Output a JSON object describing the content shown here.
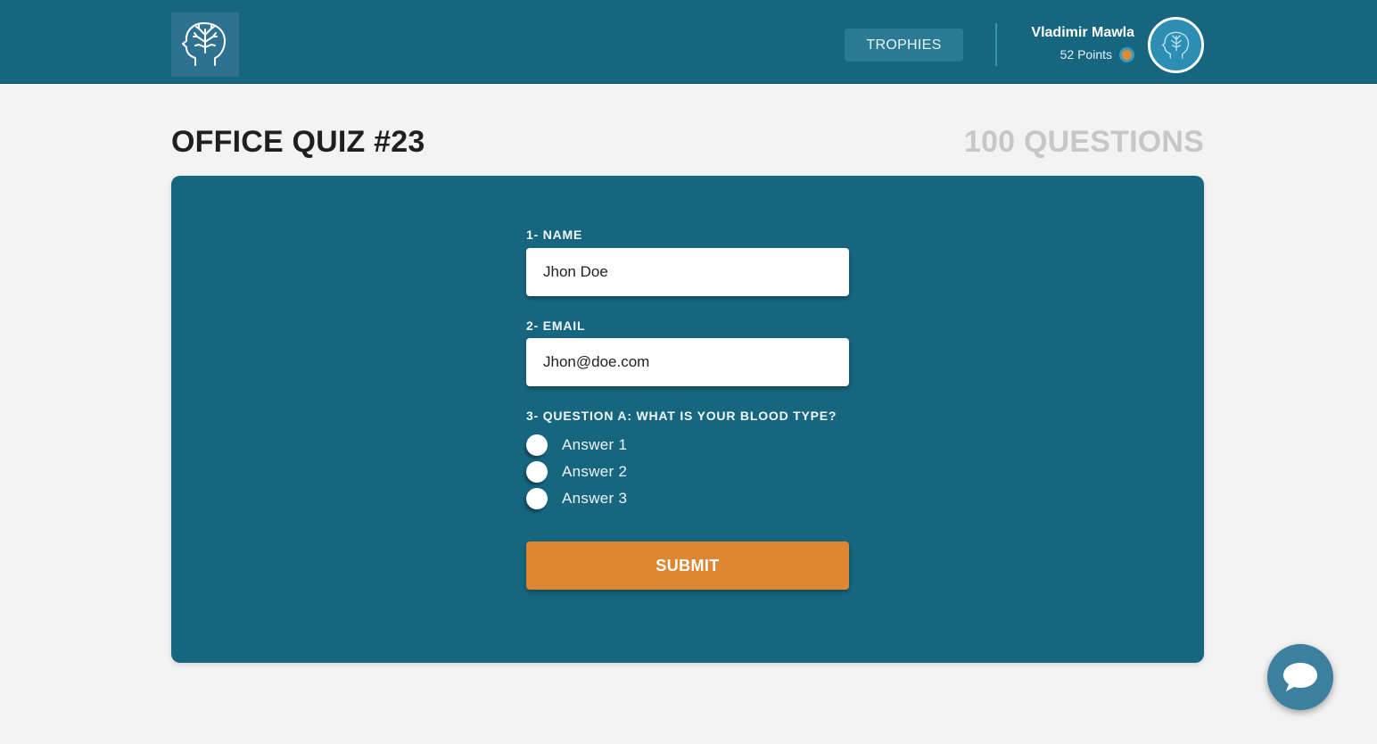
{
  "header": {
    "logo_icon": "brain-head-icon",
    "trophies_label": "TROPHIES",
    "user": {
      "name": "Vladimir Mawla",
      "points": "52 Points",
      "avatar_icon": "brain-head-icon"
    }
  },
  "quiz": {
    "title": "OFFICE QUIZ #23",
    "question_count": "100 QUESTIONS"
  },
  "form": {
    "name_label": "1- NAME",
    "name_value": "Jhon Doe",
    "email_label": "2- EMAIL",
    "email_value": "Jhon@doe.com",
    "question_label": "3- QUESTION A: WHAT IS YOUR BLOOD TYPE?",
    "answers": [
      "Answer 1",
      "Answer 2",
      "Answer 3"
    ],
    "submit_label": "SUBMIT"
  },
  "chat": {
    "icon": "chat-bubble-icon"
  },
  "colors": {
    "primary": "#17667f",
    "accent": "#df8632",
    "background": "#f3f3f3"
  }
}
